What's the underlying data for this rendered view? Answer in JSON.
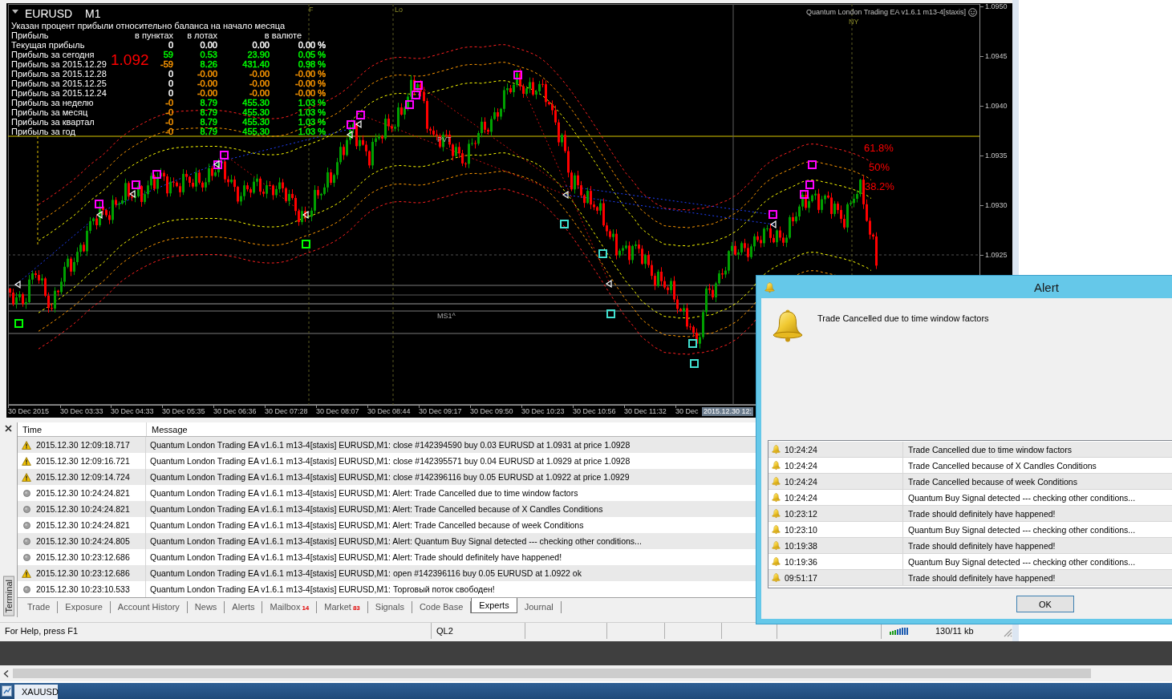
{
  "chart": {
    "symbol": "EURUSD M1",
    "expert": "Quantum London Trading EA v1.6.1 m13-4[staxis]",
    "session_labels": [
      "F",
      "Lo",
      "NY"
    ],
    "price_labels": [
      "1.0950",
      "1.0945",
      "1.0940",
      "1.0935",
      "1.0930",
      "1.0925"
    ],
    "time_labels": [
      "30 Dec 2015",
      "30 Dec 03:33",
      "30 Dec 04:33",
      "30 Dec 05:35",
      "30 Dec 06:36",
      "30 Dec 07:28",
      "30 Dec 08:07",
      "30 Dec 08:44",
      "30 Dec 09:17",
      "30 Dec 09:50",
      "30 Dec 10:23",
      "30 Dec 10:56",
      "30 Dec 11:32",
      "30 Dec"
    ],
    "cursor_time": "2015.12.30 12:",
    "fib_labels": [
      "61.8%",
      "50%",
      "38.2%"
    ],
    "level_labels": [
      "PVT",
      "MS1^"
    ],
    "price_marker": "1.092"
  },
  "stats": {
    "caption": "Указан процент прибыли относительно баланса на начало месяца",
    "headers": [
      "Прибыль",
      "в пунктах",
      "в лотах",
      "в валюте"
    ],
    "rows": [
      {
        "label": "Текущая прибыль",
        "values": [
          {
            "text": "0",
            "color": "#ffffff"
          },
          {
            "text": "0.00",
            "color": "#ffffff"
          },
          {
            "text": "0.00",
            "color": "#ffffff"
          },
          {
            "text": "0.00 %",
            "color": "#ffffff"
          }
        ]
      },
      {
        "label": "Прибыль за сегодня",
        "values": [
          {
            "text": "59",
            "color": "#00ff00"
          },
          {
            "text": "0.53",
            "color": "#00ff00"
          },
          {
            "text": "23.90",
            "color": "#00ff00"
          },
          {
            "text": "0.05 %",
            "color": "#00ff00"
          }
        ]
      },
      {
        "label": "Прибыль за 2015.12.29",
        "values": [
          {
            "text": "-59",
            "color": "#ff9900"
          },
          {
            "text": "8.26",
            "color": "#00ff00"
          },
          {
            "text": "431.40",
            "color": "#00ff00"
          },
          {
            "text": "0.98 %",
            "color": "#00ff00"
          }
        ]
      },
      {
        "label": "Прибыль за 2015.12.28",
        "values": [
          {
            "text": "0",
            "color": "#ffffff"
          },
          {
            "text": "-0.00",
            "color": "#ff9900"
          },
          {
            "text": "-0.00",
            "color": "#ff9900"
          },
          {
            "text": "-0.00 %",
            "color": "#ff9900"
          }
        ]
      },
      {
        "label": "Прибыль за 2015.12.25",
        "values": [
          {
            "text": "0",
            "color": "#ffffff"
          },
          {
            "text": "-0.00",
            "color": "#ff9900"
          },
          {
            "text": "-0.00",
            "color": "#ff9900"
          },
          {
            "text": "-0.00 %",
            "color": "#ff9900"
          }
        ]
      },
      {
        "label": "Прибыль за 2015.12.24",
        "values": [
          {
            "text": "0",
            "color": "#ffffff"
          },
          {
            "text": "-0.00",
            "color": "#ff9900"
          },
          {
            "text": "-0.00",
            "color": "#ff9900"
          },
          {
            "text": "-0.00 %",
            "color": "#ff9900"
          }
        ]
      },
      {
        "label": "Прибыль за неделю",
        "values": [
          {
            "text": "-0",
            "color": "#ff9900"
          },
          {
            "text": "8.79",
            "color": "#00ff00"
          },
          {
            "text": "455.30",
            "color": "#00ff00"
          },
          {
            "text": "1.03 %",
            "color": "#00ff00"
          }
        ]
      },
      {
        "label": "Прибыль за месяц",
        "values": [
          {
            "text": "-0",
            "color": "#ff9900"
          },
          {
            "text": "8.79",
            "color": "#00ff00"
          },
          {
            "text": "455.30",
            "color": "#00ff00"
          },
          {
            "text": "1.03 %",
            "color": "#00ff00"
          }
        ]
      },
      {
        "label": "Прибыль за квартал",
        "values": [
          {
            "text": "-0",
            "color": "#ff9900"
          },
          {
            "text": "8.79",
            "color": "#00ff00"
          },
          {
            "text": "455.30",
            "color": "#00ff00"
          },
          {
            "text": "1.03 %",
            "color": "#00ff00"
          }
        ]
      },
      {
        "label": "Прибыль за год",
        "values": [
          {
            "text": "-0",
            "color": "#ff9900"
          },
          {
            "text": "8.79",
            "color": "#00ff00"
          },
          {
            "text": "455.30",
            "color": "#00ff00"
          },
          {
            "text": "1.03 %",
            "color": "#00ff00"
          }
        ]
      }
    ]
  },
  "terminal": {
    "title": "Terminal",
    "columns": [
      "Time",
      "Message"
    ],
    "rows": [
      {
        "kind": "warning",
        "time": "2015.12.30 12:09:18.717",
        "message": "Quantum London Trading EA v1.6.1 m13-4[staxis] EURUSD,M1: close #142394590 buy 0.03 EURUSD at 1.0931 at price 1.0928"
      },
      {
        "kind": "warning",
        "time": "2015.12.30 12:09:16.721",
        "message": "Quantum London Trading EA v1.6.1 m13-4[staxis] EURUSD,M1: close #142395571 buy 0.04 EURUSD at 1.0929 at price 1.0928"
      },
      {
        "kind": "warning",
        "time": "2015.12.30 12:09:14.724",
        "message": "Quantum London Trading EA v1.6.1 m13-4[staxis] EURUSD,M1: close #142396116 buy 0.05 EURUSD at 1.0922 at price 1.0929"
      },
      {
        "kind": "message",
        "time": "2015.12.30 10:24:24.821",
        "message": "Quantum London Trading EA v1.6.1 m13-4[staxis] EURUSD,M1: Alert: Trade Cancelled due to time window factors"
      },
      {
        "kind": "message",
        "time": "2015.12.30 10:24:24.821",
        "message": "Quantum London Trading EA v1.6.1 m13-4[staxis] EURUSD,M1: Alert: Trade Cancelled because of X Candles Conditions"
      },
      {
        "kind": "message",
        "time": "2015.12.30 10:24:24.821",
        "message": "Quantum London Trading EA v1.6.1 m13-4[staxis] EURUSD,M1: Alert: Trade Cancelled because of week Conditions"
      },
      {
        "kind": "message",
        "time": "2015.12.30 10:24:24.805",
        "message": "Quantum London Trading EA v1.6.1 m13-4[staxis] EURUSD,M1: Alert: Quantum Buy Signal detected --- checking other conditions..."
      },
      {
        "kind": "message",
        "time": "2015.12.30 10:23:12.686",
        "message": "Quantum London Trading EA v1.6.1 m13-4[staxis] EURUSD,M1: Alert: Trade should definitely have happened!"
      },
      {
        "kind": "warning",
        "time": "2015.12.30 10:23:12.686",
        "message": "Quantum London Trading EA v1.6.1 m13-4[staxis] EURUSD,M1: open #142396116 buy 0.05 EURUSD at 1.0922 ok"
      },
      {
        "kind": "message",
        "time": "2015.12.30 10:23:10.533",
        "message": "Quantum London Trading EA v1.6.1 m13-4[staxis] EURUSD,M1: Торговый поток свободен!"
      }
    ],
    "tabs": [
      {
        "label": "Trade",
        "selected": false
      },
      {
        "label": "Exposure",
        "selected": false
      },
      {
        "label": "Account History",
        "selected": false
      },
      {
        "label": "News",
        "selected": false
      },
      {
        "label": "Alerts",
        "selected": false
      },
      {
        "label": "Mailbox",
        "badge": "14",
        "selected": false
      },
      {
        "label": "Market",
        "badge": "83",
        "selected": false
      },
      {
        "label": "Signals",
        "selected": false
      },
      {
        "label": "Code Base",
        "selected": false
      },
      {
        "label": "Experts",
        "selected": true
      },
      {
        "label": "Journal",
        "selected": false
      }
    ]
  },
  "status_bar": {
    "help": "For Help, press F1",
    "profile": "QL2",
    "traffic": "130/11 kb"
  },
  "alert": {
    "title": "Alert",
    "message": "Trade Cancelled due to time window factors",
    "rows": [
      {
        "time": "10:24:24",
        "message": "Trade Cancelled due to time window factors"
      },
      {
        "time": "10:24:24",
        "message": "Trade Cancelled because of X Candles Conditions"
      },
      {
        "time": "10:24:24",
        "message": "Trade Cancelled because of week Conditions"
      },
      {
        "time": "10:24:24",
        "message": "Quantum Buy Signal detected --- checking other conditions..."
      },
      {
        "time": "10:23:12",
        "message": "Trade should definitely have happened!"
      },
      {
        "time": "10:23:10",
        "message": "Quantum Buy Signal detected --- checking other conditions..."
      },
      {
        "time": "10:19:38",
        "message": "Trade should definitely have happened!"
      },
      {
        "time": "10:19:36",
        "message": "Quantum Buy Signal detected --- checking other conditions..."
      },
      {
        "time": "09:51:17",
        "message": "Trade should definitely have happened!"
      }
    ],
    "buttons": [
      "OK"
    ]
  },
  "taskbar": {
    "items": [
      "XAUUSD"
    ]
  }
}
